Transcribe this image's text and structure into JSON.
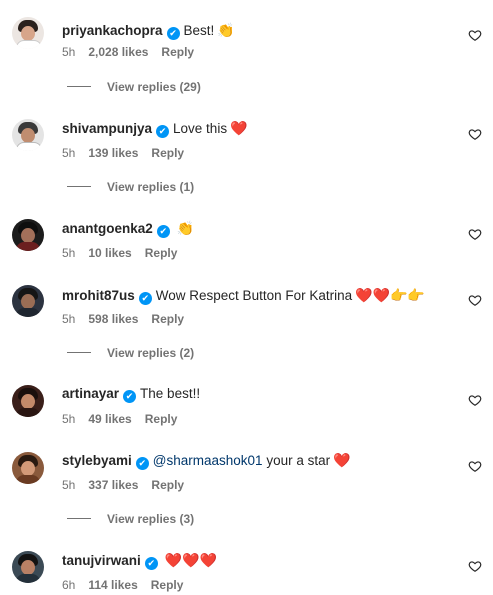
{
  "comments": [
    {
      "username": "priyankachopra",
      "text": "Best!",
      "emoji": "👏",
      "time": "5h",
      "likes": "2,028 likes",
      "reply": "Reply",
      "view_replies": "View replies (29)"
    },
    {
      "username": "shivampunjya",
      "text": "Love this",
      "emoji": "❤️",
      "time": "5h",
      "likes": "139 likes",
      "reply": "Reply",
      "view_replies": "View replies (1)"
    },
    {
      "username": "anantgoenka2",
      "text": "",
      "emoji": "👏",
      "time": "5h",
      "likes": "10 likes",
      "reply": "Reply"
    },
    {
      "username": "mrohit87us",
      "text": "Wow Respect Button For Katrina",
      "emoji": "❤️❤️👉👉",
      "time": "5h",
      "likes": "598 likes",
      "reply": "Reply",
      "view_replies": "View replies (2)"
    },
    {
      "username": "artinayar",
      "text": "The best!!",
      "emoji": "",
      "time": "5h",
      "likes": "49 likes",
      "reply": "Reply"
    },
    {
      "username": "stylebyami",
      "mention": "@sharmaashok01",
      "text": "your a star",
      "emoji": "❤️",
      "time": "5h",
      "likes": "337 likes",
      "reply": "Reply",
      "view_replies": "View replies (3)"
    },
    {
      "username": "tanujvirwani",
      "text": "",
      "emoji": "❤️❤️❤️",
      "time": "6h",
      "likes": "114 likes",
      "reply": "Reply"
    }
  ],
  "verified_mark": "✔",
  "colors": {
    "verified": "#0095f6",
    "meta": "#737373",
    "text": "#262626",
    "mention": "#00376b",
    "heart": "#e0245e"
  }
}
